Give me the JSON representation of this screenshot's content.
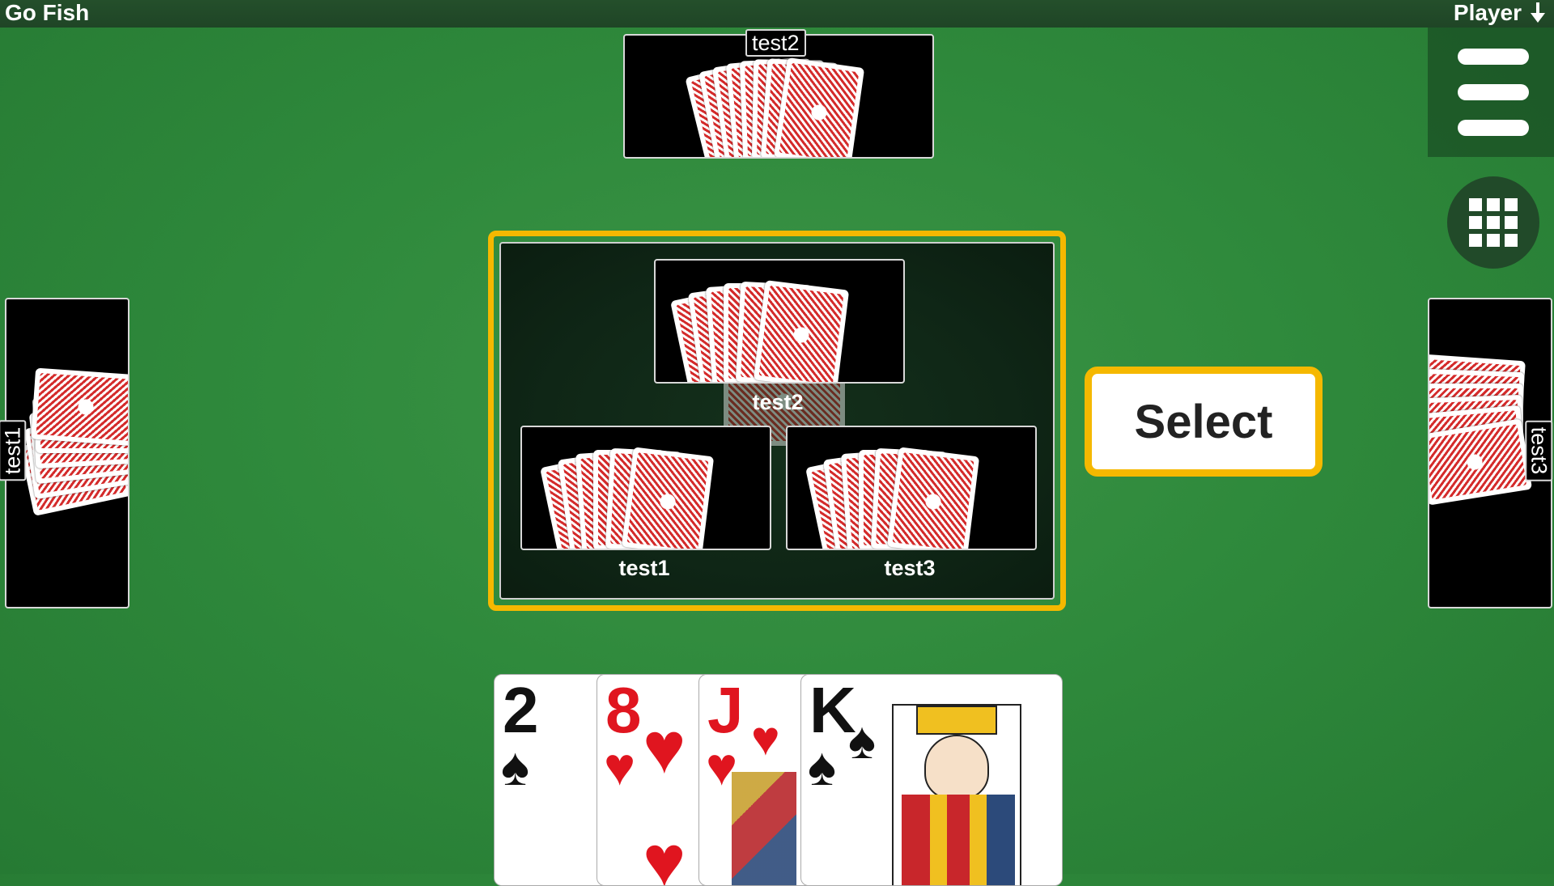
{
  "app": {
    "title": "Go Fish",
    "player_label": "Player"
  },
  "opponents": {
    "top": {
      "name": "test2"
    },
    "left": {
      "name": "test1"
    },
    "right": {
      "name": "test3"
    }
  },
  "dialog": {
    "choices": [
      {
        "name": "test2"
      },
      {
        "name": "test1"
      },
      {
        "name": "test3"
      }
    ]
  },
  "select_button": {
    "label": "Select"
  },
  "hand": [
    {
      "rank": "2",
      "suit": "♠",
      "color": "black"
    },
    {
      "rank": "8",
      "suit": "♥",
      "color": "red"
    },
    {
      "rank": "J",
      "suit": "♥",
      "color": "red"
    },
    {
      "rank": "K",
      "suit": "♠",
      "color": "black"
    }
  ],
  "colors": {
    "felt": "#2f8a3c",
    "accent": "#f5b800",
    "card_back": "#d42b2b"
  },
  "icons": [
    "arrow-down-icon",
    "hamburger-menu-icon",
    "grid-icon"
  ]
}
